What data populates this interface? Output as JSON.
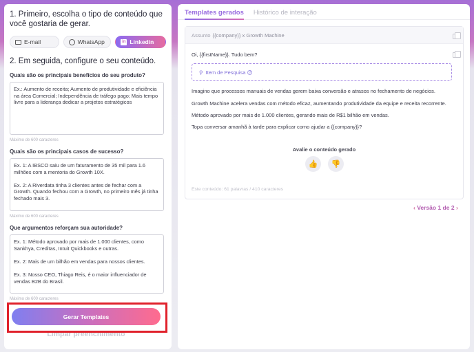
{
  "left": {
    "step1_title": "1. Primeiro, escolha o tipo de conteúdo que você gostaria de gerar.",
    "channels": [
      {
        "label": "E-mail",
        "icon": "mail-icon",
        "active": false
      },
      {
        "label": "WhatsApp",
        "icon": "whatsapp-icon",
        "active": false
      },
      {
        "label": "Linkedin",
        "icon": "linkedin-icon",
        "active": true
      }
    ],
    "step2_title": "2. Em seguida, configure o seu conteúdo.",
    "questions": [
      {
        "label": "Quais são os principais benefícios do seu produto?",
        "value": "Ex.: Aumento de receita; Aumento de produtividade e eficiência na área Comercial; Independência de tráfego pago; Mais tempo livre para a liderança dedicar a projetos estratégicos",
        "hint": "Máximo de 600 caracteres"
      },
      {
        "label": "Quais são os principais casos de sucesso?",
        "value": "Ex. 1: A IBSCO saiu de um faturamento de 35 mil para 1.6 milhões com a mentoria do Growth 10X.\n\nEx. 2: A Riverdata tinha 3 clientes antes de fechar com a Growth. Quando fechou com a Growth, no primeiro mês já tinha fechado mais 3.",
        "hint": "Máximo de 600 caracteres"
      },
      {
        "label": "Que argumentos reforçam sua autoridade?",
        "value": "Ex. 1: Método aprovado por mais de 1.000 clientes, como Sankhya, Creditas, Intuit Quickbooks e outras.\n\nEx. 2: Mais de um bilhão em vendas para nossos clientes.\n\nEx. 3: Nosso CEO, Thiago Reis, é o maior influenciador de vendas B2B do Brasil.",
        "hint": "Máximo de 600 caracteres"
      }
    ],
    "generate_label": "Gerar Templates",
    "clear_label": "Limpar preenchimento"
  },
  "right": {
    "tabs": [
      "Templates gerados",
      "Histórico de interação"
    ],
    "subject_label": "Assunto",
    "subject_value": "{{company}} x Growth Machine",
    "greeting": "Oi, {{firstName}}. Tudo bem?",
    "research_label": "Item de Pesquisa",
    "paragraphs": [
      "Imagino que processos manuais de vendas gerem baixa conversão e atrasos no fechamento de negócios.",
      "Growth Machine acelera vendas com método eficaz, aumentando produtividade da equipe e receita recorrente.",
      "Método aprovado por mais de 1.000 clientes, gerando mais de R$1 bilhão em vendas.",
      "Topa conversar amanhã à tarde para explicar como ajudar a {{company}}?"
    ],
    "rate_label": "Avalie o conteúdo gerado",
    "stats": "Este conteúdo: 61 palavras / 410 caracteres",
    "version": "Versão 1 de 2"
  }
}
